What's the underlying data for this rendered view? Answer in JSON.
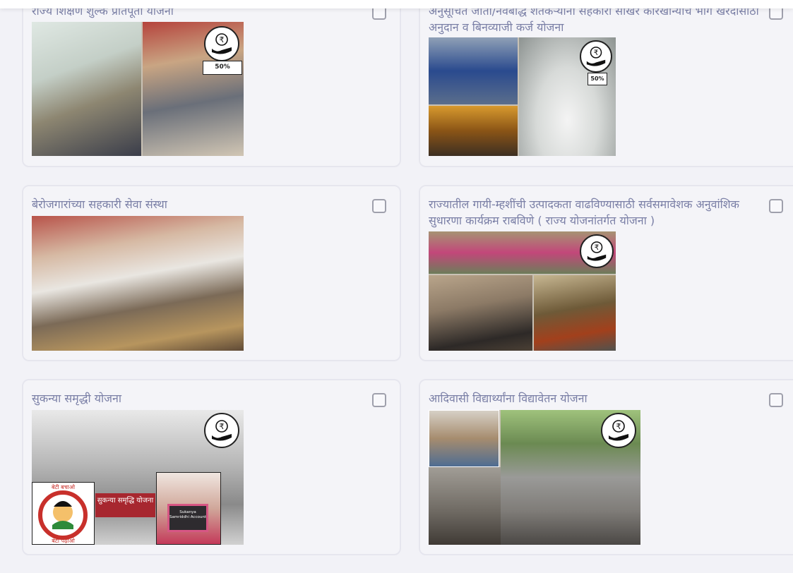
{
  "cards": [
    {
      "id": "c1",
      "title": "राज्य शिक्षण शुल्क प्रतिपूर्ती योजना",
      "badge_text": "50%"
    },
    {
      "id": "c2",
      "title": "अनुसूचित जाती/नवबौद्ध शेतकऱ्यांना सहकारी साखर कारखान्यांचे भाग खरेदीसाठी अनुदान व बिनव्याजी कर्ज योजना",
      "badge_text": "50%"
    },
    {
      "id": "c3",
      "title": "बेरोजगारांच्या सहकारी सेवा संस्था"
    },
    {
      "id": "c4",
      "title": "राज्यातील गायी-म्हशींची उत्पादकता वाढविण्यासाठी सर्वसमावेशक अनुवांशिक सुधारणा कार्यक्रम राबविणे ( राज्य योजनांतर्गत योजना )"
    },
    {
      "id": "c5",
      "title": "सुकन्या समृद्धी योजना",
      "image_caption": "सुकन्या समृद्धि योजना",
      "logo_top": "बेटी बचाओ",
      "logo_bottom": "बेटी पढ़ाओ",
      "board_text": "Sukanya Samriddhi Account"
    },
    {
      "id": "c6",
      "title": "आदिवासी विद्यार्थ्यांना विद्यावेतन योजना"
    }
  ],
  "icons": {
    "rupee_badge": "rupee-hand-icon",
    "checkbox": "checkbox-icon"
  },
  "colors": {
    "background": "#f2f2f7",
    "title_text": "#7a7fa6",
    "card_border": "#e6e6ee",
    "checkbox_border": "#9fa0ac"
  }
}
